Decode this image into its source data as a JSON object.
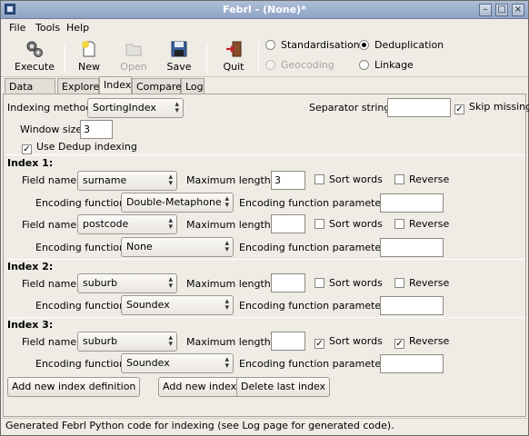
{
  "window": {
    "title": "Febrl - (None)*"
  },
  "menu": {
    "file": "File",
    "tools": "Tools",
    "help": "Help"
  },
  "toolbar": {
    "execute": "Execute",
    "new": "New",
    "open": "Open",
    "save": "Save",
    "quit": "Quit"
  },
  "modes": {
    "standardisation": "Standardisation",
    "deduplication": "Deduplication",
    "geocoding": "Geocoding",
    "linkage": "Linkage",
    "selected": "Deduplication"
  },
  "tabs": [
    "Data",
    "Explore",
    "Index",
    "Compare",
    "Log"
  ],
  "active_tab": "Index",
  "index_page": {
    "indexing_method_label": "Indexing method:",
    "indexing_method": "SortingIndex",
    "separator_label": "Separator string:",
    "separator_value": "",
    "skip_missing_label": "Skip missing",
    "skip_missing": true,
    "window_size_label": "Window size:",
    "window_size": "3",
    "use_dedup_label": "Use Dedup indexing",
    "use_dedup": true,
    "field_name_label": "Field name:",
    "max_length_label": "Maximum length:",
    "sort_words_label": "Sort words",
    "reverse_label": "Reverse",
    "encoding_function_label": "Encoding function:",
    "encoding_params_label": "Encoding function parameters:",
    "indexes": [
      {
        "title": "Index 1:",
        "rows": [
          {
            "field": "surname",
            "max_length": "3",
            "sort_words": false,
            "reverse": false,
            "encoding": "Double-Metaphone",
            "params": ""
          },
          {
            "field": "postcode",
            "max_length": "",
            "sort_words": false,
            "reverse": false,
            "encoding": "None",
            "params": ""
          }
        ]
      },
      {
        "title": "Index 2:",
        "rows": [
          {
            "field": "suburb",
            "max_length": "",
            "sort_words": false,
            "reverse": false,
            "encoding": "Soundex",
            "params": ""
          }
        ]
      },
      {
        "title": "Index 3:",
        "rows": [
          {
            "field": "suburb",
            "max_length": "",
            "sort_words": true,
            "reverse": true,
            "encoding": "Soundex",
            "params": ""
          }
        ]
      }
    ],
    "buttons": {
      "add_definition": "Add new index definition",
      "add_index": "Add new index",
      "delete_last": "Delete last index"
    }
  },
  "status": "Generated Febrl Python code for indexing (see Log page for generated code)."
}
